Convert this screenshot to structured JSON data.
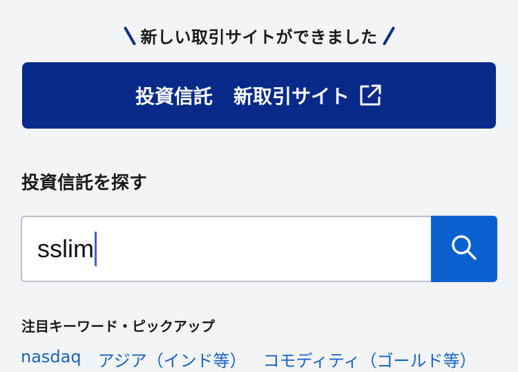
{
  "announcement": {
    "text": "新しい取引サイトができました"
  },
  "banner_button": {
    "label_part1": "投資信託",
    "label_part2": "新取引サイト",
    "icon": "external-link-icon"
  },
  "search_section": {
    "title": "投資信託を探す",
    "input_value": "sslim",
    "button_icon": "search-icon"
  },
  "pickup": {
    "title": "注目キーワード・ピックアップ",
    "keywords": [
      "nasdaq",
      "アジア（インド等）",
      "コモディティ（ゴールド等）"
    ]
  },
  "colors": {
    "background": "#f3f4f6",
    "banner": "#0a2a8a",
    "search_button": "#0b60d0",
    "link": "#1463c9"
  }
}
